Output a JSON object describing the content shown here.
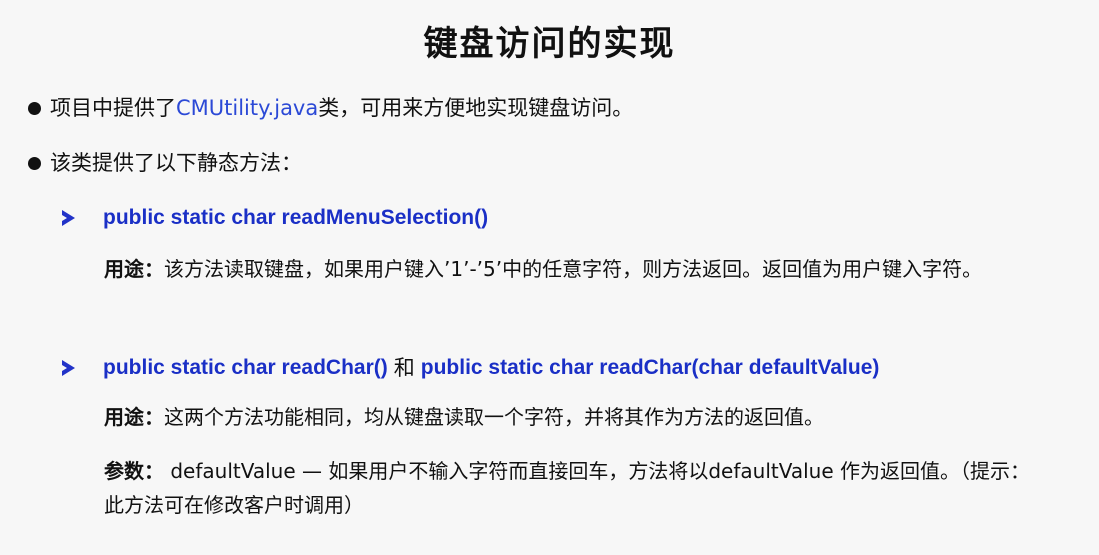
{
  "title": "键盘访问的实现",
  "bullets": [
    {
      "prefix": "项目中提供了",
      "link": "CMUtility.java",
      "suffix": "类，可用来方便地实现键盘访问。"
    },
    {
      "text": "该类提供了以下静态方法："
    }
  ],
  "methods": [
    {
      "signature": "public static char readMenuSelection()",
      "usage_label": "用途：",
      "usage_text": "该方法读取键盘，如果用户键入’1’-’5’中的任意字符，则方法返回。返回值为用户键入字符。"
    },
    {
      "signature_a": "public static char readChar()",
      "joiner": "和",
      "signature_b": "public static char readChar(char defaultValue)",
      "usage_label": "用途：",
      "usage_text": "这两个方法功能相同，均从键盘读取一个字符，并将其作为方法的返回值。",
      "param_label": "参数：",
      "param_text": " defaultValue — 如果用户不输入字符而直接回车，方法将以defaultValue 作为返回值。（提示：此方法可在修改客户时调用）"
    }
  ],
  "colors": {
    "link": "#2b49d6",
    "code": "#1a2fc6",
    "arrow": "#2233c8"
  }
}
